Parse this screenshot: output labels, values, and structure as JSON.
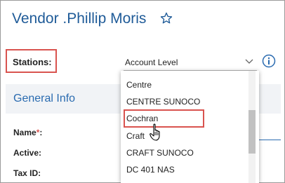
{
  "header": {
    "title": "Vendor .Phillip Moris",
    "favorite_icon": "star-outline-icon"
  },
  "stations": {
    "label": "Stations:",
    "selected_value": "Account Level",
    "caret_icon": "chevron-down-icon",
    "info_icon": "info-circle-icon"
  },
  "section": {
    "title": "General Info"
  },
  "fields": {
    "name_label": "Name",
    "name_required": "*",
    "name_colon": ":",
    "active_label": "Active:",
    "tax_id_label": "Tax ID:"
  },
  "dropdown": {
    "options": [
      "Centre",
      "CENTRE SUNOCO",
      "Cochran",
      "Craft",
      "CRAFT SUNOCO",
      "DC 401 NAS"
    ],
    "hovered": "Cochran"
  },
  "colors": {
    "accent": "#2a6bb0",
    "highlight_border": "#d9534f",
    "section_bg": "#f1f3f6"
  }
}
